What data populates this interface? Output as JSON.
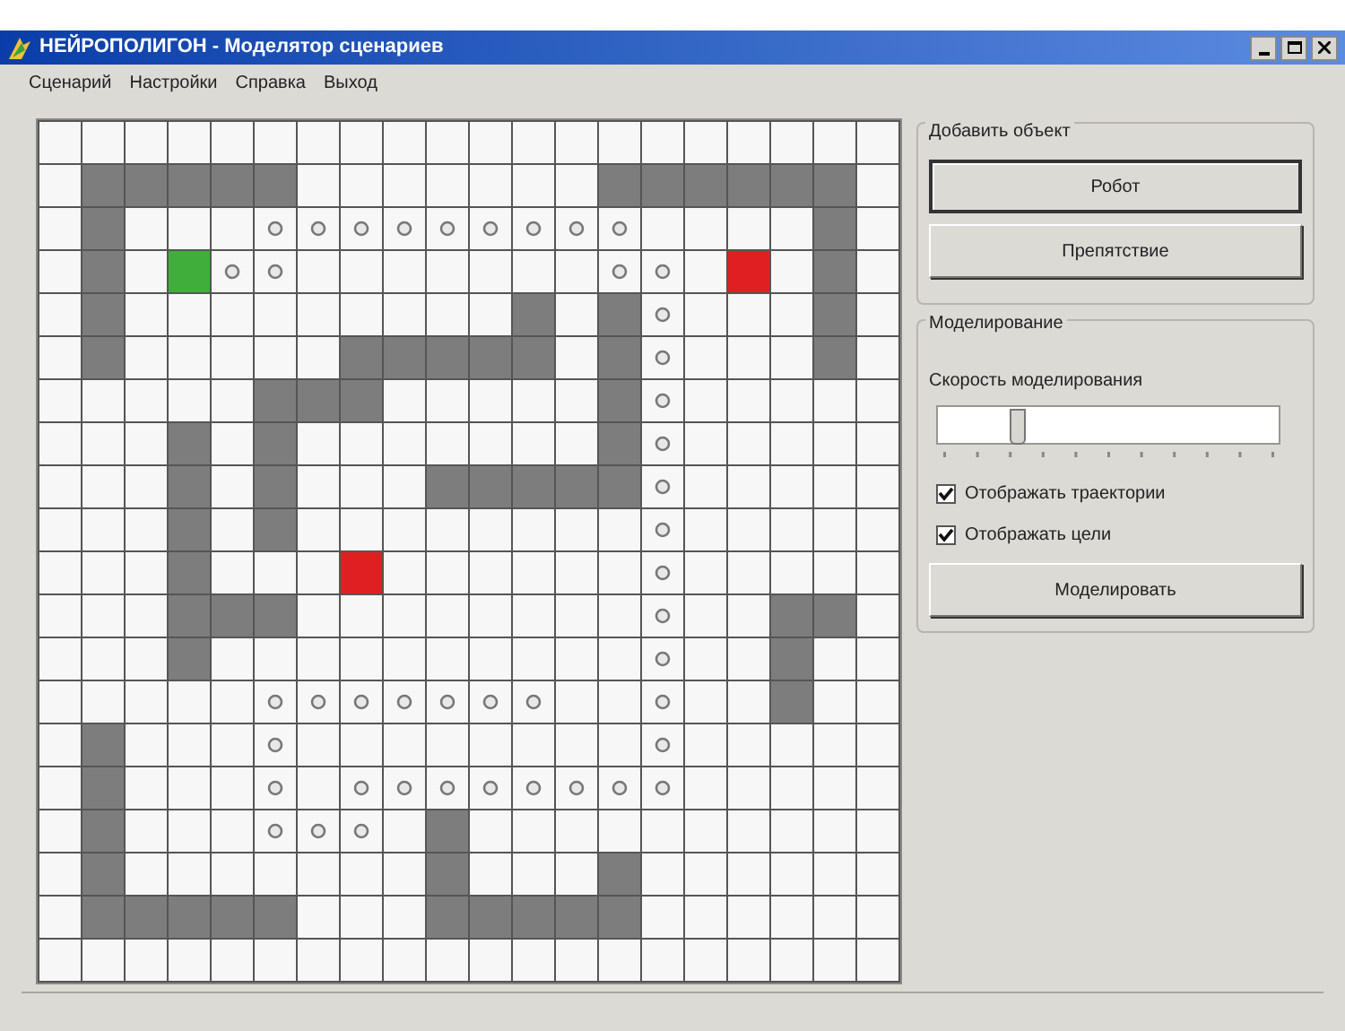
{
  "window": {
    "title": "НЕЙРОПОЛИГОН - Моделятор сценариев"
  },
  "menu": [
    "Сценарий",
    "Настройки",
    "Справка",
    "Выход"
  ],
  "board": {
    "rows": [
      [
        {
          "kind": "empty"
        },
        {
          "kind": "empty"
        },
        {
          "kind": "empty"
        },
        {
          "kind": "empty"
        },
        {
          "kind": "empty"
        },
        {
          "kind": "empty"
        },
        {
          "kind": "empty"
        },
        {
          "kind": "empty"
        },
        {
          "kind": "empty"
        },
        {
          "kind": "empty"
        },
        {
          "kind": "empty"
        },
        {
          "kind": "empty"
        },
        {
          "kind": "empty"
        },
        {
          "kind": "empty"
        },
        {
          "kind": "empty"
        },
        {
          "kind": "empty"
        },
        {
          "kind": "empty"
        },
        {
          "kind": "empty"
        },
        {
          "kind": "empty"
        },
        {
          "kind": "empty"
        }
      ],
      [
        {
          "kind": "empty"
        },
        {
          "kind": "wall"
        },
        {
          "kind": "wall"
        },
        {
          "kind": "wall"
        },
        {
          "kind": "wall"
        },
        {
          "kind": "wall"
        },
        {
          "kind": "empty"
        },
        {
          "kind": "empty"
        },
        {
          "kind": "empty"
        },
        {
          "kind": "empty"
        },
        {
          "kind": "empty"
        },
        {
          "kind": "empty"
        },
        {
          "kind": "empty"
        },
        {
          "kind": "wall"
        },
        {
          "kind": "wall"
        },
        {
          "kind": "wall"
        },
        {
          "kind": "wall"
        },
        {
          "kind": "wall"
        },
        {
          "kind": "wall"
        },
        {
          "kind": "empty"
        }
      ],
      [
        {
          "kind": "empty"
        },
        {
          "kind": "wall"
        },
        {
          "kind": "empty"
        },
        {
          "kind": "empty"
        },
        {
          "kind": "empty"
        },
        {
          "kind": "trail"
        },
        {
          "kind": "trail"
        },
        {
          "kind": "trail"
        },
        {
          "kind": "trail"
        },
        {
          "kind": "trail"
        },
        {
          "kind": "trail"
        },
        {
          "kind": "trail"
        },
        {
          "kind": "trail"
        },
        {
          "kind": "trail"
        },
        {
          "kind": "empty"
        },
        {
          "kind": "empty"
        },
        {
          "kind": "empty"
        },
        {
          "kind": "empty"
        },
        {
          "kind": "wall"
        },
        {
          "kind": "empty"
        }
      ],
      [
        {
          "kind": "empty"
        },
        {
          "kind": "wall"
        },
        {
          "kind": "empty"
        },
        {
          "kind": "robot"
        },
        {
          "kind": "trail"
        },
        {
          "kind": "trail"
        },
        {
          "kind": "empty"
        },
        {
          "kind": "empty"
        },
        {
          "kind": "empty"
        },
        {
          "kind": "empty"
        },
        {
          "kind": "empty"
        },
        {
          "kind": "empty"
        },
        {
          "kind": "empty"
        },
        {
          "kind": "trail"
        },
        {
          "kind": "trail"
        },
        {
          "kind": "empty"
        },
        {
          "kind": "target"
        },
        {
          "kind": "empty"
        },
        {
          "kind": "wall"
        },
        {
          "kind": "empty"
        }
      ],
      [
        {
          "kind": "empty"
        },
        {
          "kind": "wall"
        },
        {
          "kind": "empty"
        },
        {
          "kind": "empty"
        },
        {
          "kind": "empty"
        },
        {
          "kind": "empty"
        },
        {
          "kind": "empty"
        },
        {
          "kind": "empty"
        },
        {
          "kind": "empty"
        },
        {
          "kind": "empty"
        },
        {
          "kind": "empty"
        },
        {
          "kind": "wall"
        },
        {
          "kind": "empty"
        },
        {
          "kind": "wall"
        },
        {
          "kind": "trail"
        },
        {
          "kind": "empty"
        },
        {
          "kind": "empty"
        },
        {
          "kind": "empty"
        },
        {
          "kind": "wall"
        },
        {
          "kind": "empty"
        }
      ],
      [
        {
          "kind": "empty"
        },
        {
          "kind": "wall"
        },
        {
          "kind": "empty"
        },
        {
          "kind": "empty"
        },
        {
          "kind": "empty"
        },
        {
          "kind": "empty"
        },
        {
          "kind": "empty"
        },
        {
          "kind": "wall"
        },
        {
          "kind": "wall"
        },
        {
          "kind": "wall"
        },
        {
          "kind": "wall"
        },
        {
          "kind": "wall"
        },
        {
          "kind": "empty"
        },
        {
          "kind": "wall"
        },
        {
          "kind": "trail"
        },
        {
          "kind": "empty"
        },
        {
          "kind": "empty"
        },
        {
          "kind": "empty"
        },
        {
          "kind": "wall"
        },
        {
          "kind": "empty"
        }
      ],
      [
        {
          "kind": "empty"
        },
        {
          "kind": "empty"
        },
        {
          "kind": "empty"
        },
        {
          "kind": "empty"
        },
        {
          "kind": "empty"
        },
        {
          "kind": "wall"
        },
        {
          "kind": "wall"
        },
        {
          "kind": "wall"
        },
        {
          "kind": "empty"
        },
        {
          "kind": "empty"
        },
        {
          "kind": "empty"
        },
        {
          "kind": "empty"
        },
        {
          "kind": "empty"
        },
        {
          "kind": "wall"
        },
        {
          "kind": "trail"
        },
        {
          "kind": "empty"
        },
        {
          "kind": "empty"
        },
        {
          "kind": "empty"
        },
        {
          "kind": "empty"
        },
        {
          "kind": "empty"
        }
      ],
      [
        {
          "kind": "empty"
        },
        {
          "kind": "empty"
        },
        {
          "kind": "empty"
        },
        {
          "kind": "wall"
        },
        {
          "kind": "empty"
        },
        {
          "kind": "wall"
        },
        {
          "kind": "empty"
        },
        {
          "kind": "empty"
        },
        {
          "kind": "empty"
        },
        {
          "kind": "empty"
        },
        {
          "kind": "empty"
        },
        {
          "kind": "empty"
        },
        {
          "kind": "empty"
        },
        {
          "kind": "wall"
        },
        {
          "kind": "trail"
        },
        {
          "kind": "empty"
        },
        {
          "kind": "empty"
        },
        {
          "kind": "empty"
        },
        {
          "kind": "empty"
        },
        {
          "kind": "empty"
        }
      ],
      [
        {
          "kind": "empty"
        },
        {
          "kind": "empty"
        },
        {
          "kind": "empty"
        },
        {
          "kind": "wall"
        },
        {
          "kind": "empty"
        },
        {
          "kind": "wall"
        },
        {
          "kind": "empty"
        },
        {
          "kind": "empty"
        },
        {
          "kind": "empty"
        },
        {
          "kind": "wall"
        },
        {
          "kind": "wall"
        },
        {
          "kind": "wall"
        },
        {
          "kind": "wall"
        },
        {
          "kind": "wall"
        },
        {
          "kind": "trail"
        },
        {
          "kind": "empty"
        },
        {
          "kind": "empty"
        },
        {
          "kind": "empty"
        },
        {
          "kind": "empty"
        },
        {
          "kind": "empty"
        }
      ],
      [
        {
          "kind": "empty"
        },
        {
          "kind": "empty"
        },
        {
          "kind": "empty"
        },
        {
          "kind": "wall"
        },
        {
          "kind": "empty"
        },
        {
          "kind": "wall"
        },
        {
          "kind": "empty"
        },
        {
          "kind": "empty"
        },
        {
          "kind": "empty"
        },
        {
          "kind": "empty"
        },
        {
          "kind": "empty"
        },
        {
          "kind": "empty"
        },
        {
          "kind": "empty"
        },
        {
          "kind": "empty"
        },
        {
          "kind": "trail"
        },
        {
          "kind": "empty"
        },
        {
          "kind": "empty"
        },
        {
          "kind": "empty"
        },
        {
          "kind": "empty"
        },
        {
          "kind": "empty"
        }
      ],
      [
        {
          "kind": "empty"
        },
        {
          "kind": "empty"
        },
        {
          "kind": "empty"
        },
        {
          "kind": "wall"
        },
        {
          "kind": "empty"
        },
        {
          "kind": "empty"
        },
        {
          "kind": "empty"
        },
        {
          "kind": "target"
        },
        {
          "kind": "empty"
        },
        {
          "kind": "empty"
        },
        {
          "kind": "empty"
        },
        {
          "kind": "empty"
        },
        {
          "kind": "empty"
        },
        {
          "kind": "empty"
        },
        {
          "kind": "trail"
        },
        {
          "kind": "empty"
        },
        {
          "kind": "empty"
        },
        {
          "kind": "empty"
        },
        {
          "kind": "empty"
        },
        {
          "kind": "empty"
        }
      ],
      [
        {
          "kind": "empty"
        },
        {
          "kind": "empty"
        },
        {
          "kind": "empty"
        },
        {
          "kind": "wall"
        },
        {
          "kind": "wall"
        },
        {
          "kind": "wall"
        },
        {
          "kind": "empty"
        },
        {
          "kind": "empty"
        },
        {
          "kind": "empty"
        },
        {
          "kind": "empty"
        },
        {
          "kind": "empty"
        },
        {
          "kind": "empty"
        },
        {
          "kind": "empty"
        },
        {
          "kind": "empty"
        },
        {
          "kind": "trail"
        },
        {
          "kind": "empty"
        },
        {
          "kind": "empty"
        },
        {
          "kind": "wall"
        },
        {
          "kind": "wall"
        },
        {
          "kind": "empty"
        }
      ],
      [
        {
          "kind": "empty"
        },
        {
          "kind": "empty"
        },
        {
          "kind": "empty"
        },
        {
          "kind": "wall"
        },
        {
          "kind": "empty"
        },
        {
          "kind": "empty"
        },
        {
          "kind": "empty"
        },
        {
          "kind": "empty"
        },
        {
          "kind": "empty"
        },
        {
          "kind": "empty"
        },
        {
          "kind": "empty"
        },
        {
          "kind": "empty"
        },
        {
          "kind": "empty"
        },
        {
          "kind": "empty"
        },
        {
          "kind": "trail"
        },
        {
          "kind": "empty"
        },
        {
          "kind": "empty"
        },
        {
          "kind": "wall"
        },
        {
          "kind": "empty"
        },
        {
          "kind": "empty"
        }
      ],
      [
        {
          "kind": "empty"
        },
        {
          "kind": "empty"
        },
        {
          "kind": "empty"
        },
        {
          "kind": "empty"
        },
        {
          "kind": "empty"
        },
        {
          "kind": "trail"
        },
        {
          "kind": "trail"
        },
        {
          "kind": "trail"
        },
        {
          "kind": "trail"
        },
        {
          "kind": "trail"
        },
        {
          "kind": "trail"
        },
        {
          "kind": "trail"
        },
        {
          "kind": "empty"
        },
        {
          "kind": "empty"
        },
        {
          "kind": "trail"
        },
        {
          "kind": "empty"
        },
        {
          "kind": "empty"
        },
        {
          "kind": "wall"
        },
        {
          "kind": "empty"
        },
        {
          "kind": "empty"
        }
      ],
      [
        {
          "kind": "empty"
        },
        {
          "kind": "wall"
        },
        {
          "kind": "empty"
        },
        {
          "kind": "empty"
        },
        {
          "kind": "empty"
        },
        {
          "kind": "trail"
        },
        {
          "kind": "empty"
        },
        {
          "kind": "empty"
        },
        {
          "kind": "empty"
        },
        {
          "kind": "empty"
        },
        {
          "kind": "empty"
        },
        {
          "kind": "empty"
        },
        {
          "kind": "empty"
        },
        {
          "kind": "empty"
        },
        {
          "kind": "trail"
        },
        {
          "kind": "empty"
        },
        {
          "kind": "empty"
        },
        {
          "kind": "empty"
        },
        {
          "kind": "empty"
        },
        {
          "kind": "empty"
        }
      ],
      [
        {
          "kind": "empty"
        },
        {
          "kind": "wall"
        },
        {
          "kind": "empty"
        },
        {
          "kind": "empty"
        },
        {
          "kind": "empty"
        },
        {
          "kind": "trail"
        },
        {
          "kind": "empty"
        },
        {
          "kind": "trail"
        },
        {
          "kind": "trail"
        },
        {
          "kind": "trail"
        },
        {
          "kind": "trail"
        },
        {
          "kind": "trail"
        },
        {
          "kind": "trail"
        },
        {
          "kind": "trail"
        },
        {
          "kind": "trail"
        },
        {
          "kind": "empty"
        },
        {
          "kind": "empty"
        },
        {
          "kind": "empty"
        },
        {
          "kind": "empty"
        },
        {
          "kind": "empty"
        }
      ],
      [
        {
          "kind": "empty"
        },
        {
          "kind": "wall"
        },
        {
          "kind": "empty"
        },
        {
          "kind": "empty"
        },
        {
          "kind": "empty"
        },
        {
          "kind": "trail"
        },
        {
          "kind": "trail"
        },
        {
          "kind": "trail"
        },
        {
          "kind": "empty"
        },
        {
          "kind": "wall"
        },
        {
          "kind": "empty"
        },
        {
          "kind": "empty"
        },
        {
          "kind": "empty"
        },
        {
          "kind": "empty"
        },
        {
          "kind": "empty"
        },
        {
          "kind": "empty"
        },
        {
          "kind": "empty"
        },
        {
          "kind": "empty"
        },
        {
          "kind": "empty"
        },
        {
          "kind": "empty"
        }
      ],
      [
        {
          "kind": "empty"
        },
        {
          "kind": "wall"
        },
        {
          "kind": "empty"
        },
        {
          "kind": "empty"
        },
        {
          "kind": "empty"
        },
        {
          "kind": "empty"
        },
        {
          "kind": "empty"
        },
        {
          "kind": "empty"
        },
        {
          "kind": "empty"
        },
        {
          "kind": "wall"
        },
        {
          "kind": "empty"
        },
        {
          "kind": "empty"
        },
        {
          "kind": "empty"
        },
        {
          "kind": "wall"
        },
        {
          "kind": "empty"
        },
        {
          "kind": "empty"
        },
        {
          "kind": "empty"
        },
        {
          "kind": "empty"
        },
        {
          "kind": "empty"
        },
        {
          "kind": "empty"
        }
      ],
      [
        {
          "kind": "empty"
        },
        {
          "kind": "wall"
        },
        {
          "kind": "wall"
        },
        {
          "kind": "wall"
        },
        {
          "kind": "wall"
        },
        {
          "kind": "wall"
        },
        {
          "kind": "empty"
        },
        {
          "kind": "empty"
        },
        {
          "kind": "empty"
        },
        {
          "kind": "wall"
        },
        {
          "kind": "wall"
        },
        {
          "kind": "wall"
        },
        {
          "kind": "wall"
        },
        {
          "kind": "wall"
        },
        {
          "kind": "empty"
        },
        {
          "kind": "empty"
        },
        {
          "kind": "empty"
        },
        {
          "kind": "empty"
        },
        {
          "kind": "empty"
        },
        {
          "kind": "empty"
        }
      ],
      [
        {
          "kind": "empty"
        },
        {
          "kind": "empty"
        },
        {
          "kind": "empty"
        },
        {
          "kind": "empty"
        },
        {
          "kind": "empty"
        },
        {
          "kind": "empty"
        },
        {
          "kind": "empty"
        },
        {
          "kind": "empty"
        },
        {
          "kind": "empty"
        },
        {
          "kind": "empty"
        },
        {
          "kind": "empty"
        },
        {
          "kind": "empty"
        },
        {
          "kind": "empty"
        },
        {
          "kind": "empty"
        },
        {
          "kind": "empty"
        },
        {
          "kind": "empty"
        },
        {
          "kind": "empty"
        },
        {
          "kind": "empty"
        },
        {
          "kind": "empty"
        },
        {
          "kind": "empty"
        }
      ]
    ]
  },
  "add_object": {
    "title": "Добавить объект",
    "buttons": [
      {
        "label": "Робот",
        "default": true
      },
      {
        "label": "Препятствие",
        "default": false
      }
    ]
  },
  "simulation": {
    "title": "Моделирование",
    "speed_label": "Скорость моделирования",
    "speed": {
      "level": 0.22
    },
    "options": [
      {
        "label": "Отображать траектории",
        "checked": true
      },
      {
        "label": "Отображать цели",
        "checked": true
      }
    ],
    "run_button": "Моделировать"
  }
}
